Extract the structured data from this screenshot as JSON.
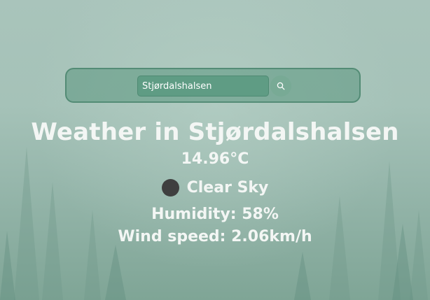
{
  "search": {
    "value": "Stjørdalshalsen",
    "button_icon": "search-icon"
  },
  "weather": {
    "title": "Weather in Stjørdalshalsen",
    "temperature": "14.96°C",
    "description": "Clear Sky",
    "description_icon": "weather-condition-icon",
    "humidity": "Humidity: 58%",
    "wind": "Wind speed: 2.06km/h"
  },
  "colors": {
    "panel": "#5a967d",
    "input": "#5f9c84",
    "text": "#f3f6f4",
    "icon_dot": "#3f3f3f"
  }
}
